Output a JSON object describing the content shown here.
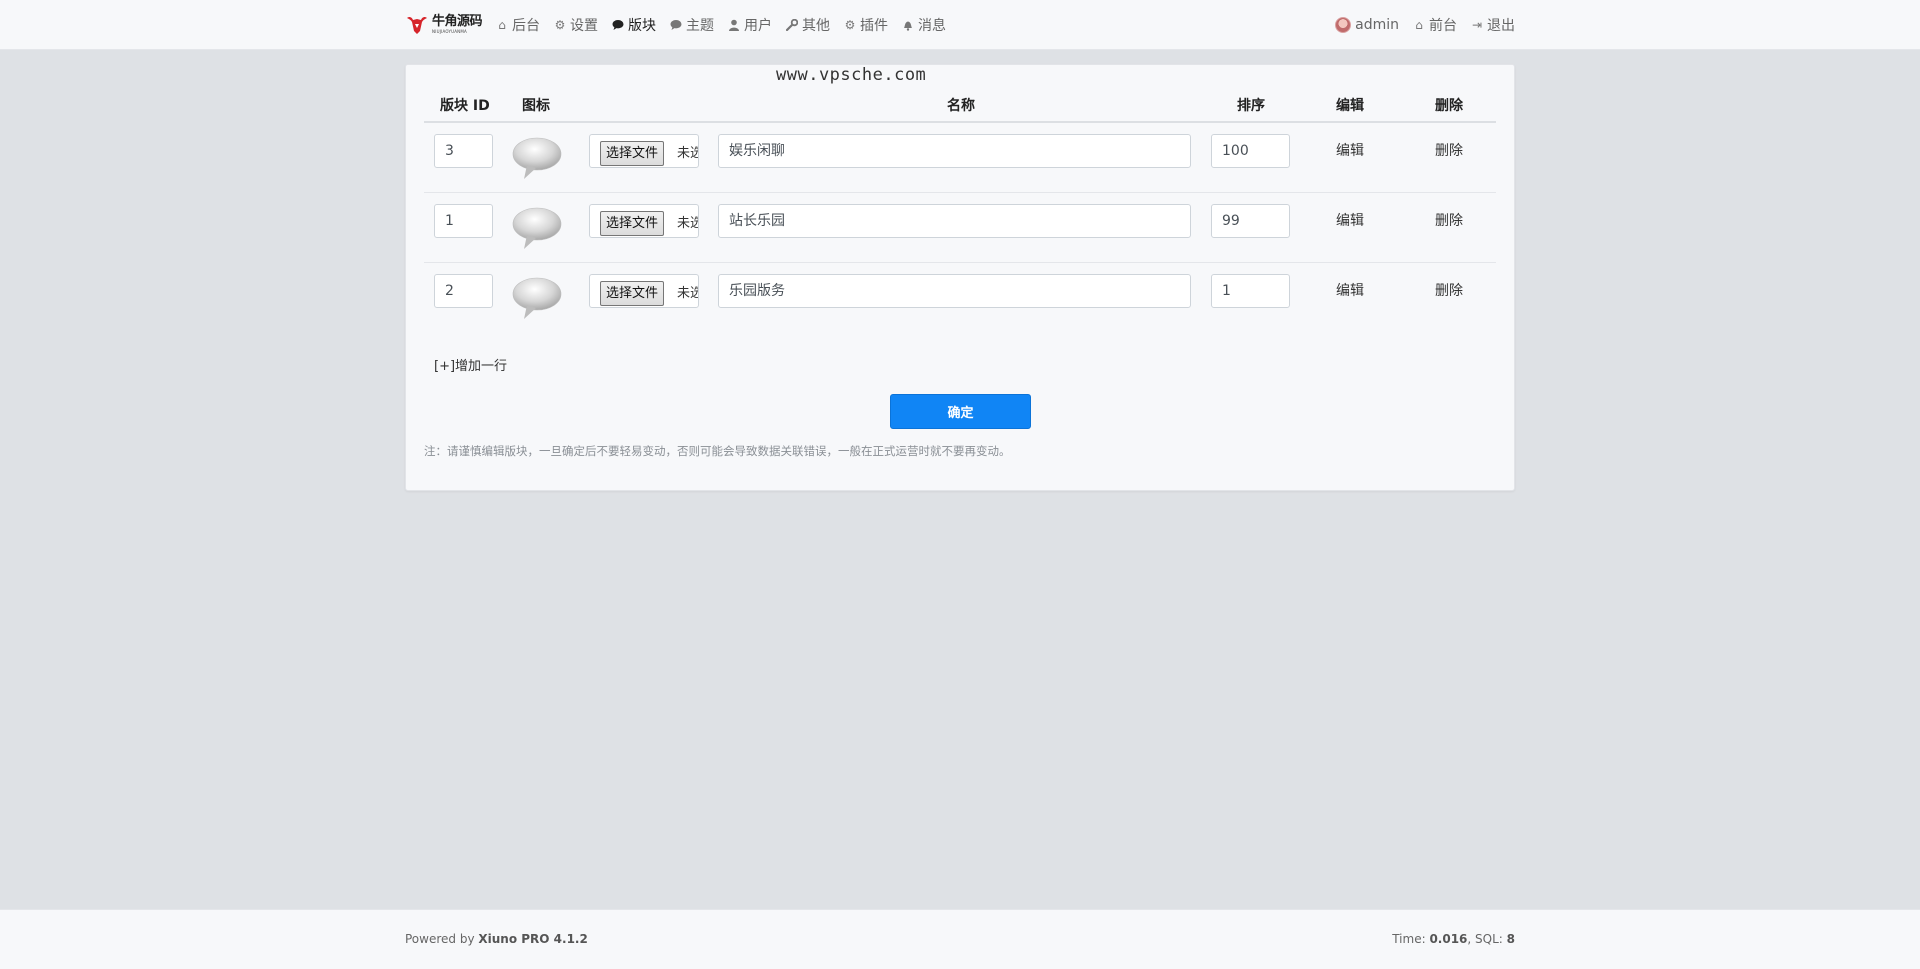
{
  "brand": {
    "name": "牛角源码",
    "tagline": "NIUJIAOYUANMA"
  },
  "nav": {
    "items": [
      {
        "label": "后台",
        "icon": "home-icon"
      },
      {
        "label": "设置",
        "icon": "gear-icon"
      },
      {
        "label": "版块",
        "icon": "comment-icon"
      },
      {
        "label": "主题",
        "icon": "comment-icon"
      },
      {
        "label": "用户",
        "icon": "user-icon"
      },
      {
        "label": "其他",
        "icon": "wrench-icon"
      },
      {
        "label": "插件",
        "icon": "gears-icon"
      },
      {
        "label": "消息",
        "icon": "bell-icon"
      }
    ],
    "active_index": 2,
    "user": "admin",
    "front": "前台",
    "logout": "退出"
  },
  "watermark": "www.vpsche.com",
  "table": {
    "headers": {
      "id": "版块 ID",
      "icon": "图标",
      "name": "名称",
      "rank": "排序",
      "edit": "编辑",
      "delete": "删除"
    },
    "rows": [
      {
        "id": "3",
        "name": "娱乐闲聊",
        "rank": "100",
        "file_button": "选择文件",
        "file_status": "未选择任何文件",
        "edit": "编辑",
        "delete": "删除"
      },
      {
        "id": "1",
        "name": "站长乐园",
        "rank": "99",
        "file_button": "选择文件",
        "file_status": "未选择任何文件",
        "edit": "编辑",
        "delete": "删除"
      },
      {
        "id": "2",
        "name": "乐园版务",
        "rank": "1",
        "file_button": "选择文件",
        "file_status": "未选择任何文件",
        "edit": "编辑",
        "delete": "删除"
      }
    ]
  },
  "add_row": "[+]增加一行",
  "submit": "确定",
  "note": "注：请谨慎编辑版块，一旦确定后不要轻易变动，否则可能会导致数据关联错误，一般在正式运营时就不要再变动。",
  "footer": {
    "powered_prefix": "Powered by ",
    "product": "Xiuno PRO 4.1.2",
    "time_label": "Time: ",
    "time_value": "0.016",
    "sql_label": ", SQL: ",
    "sql_value": "8"
  },
  "colors": {
    "primary": "#1085f5",
    "background": "#dee1e5",
    "panel": "#f7f8fa",
    "logo_red": "#d6242a"
  }
}
